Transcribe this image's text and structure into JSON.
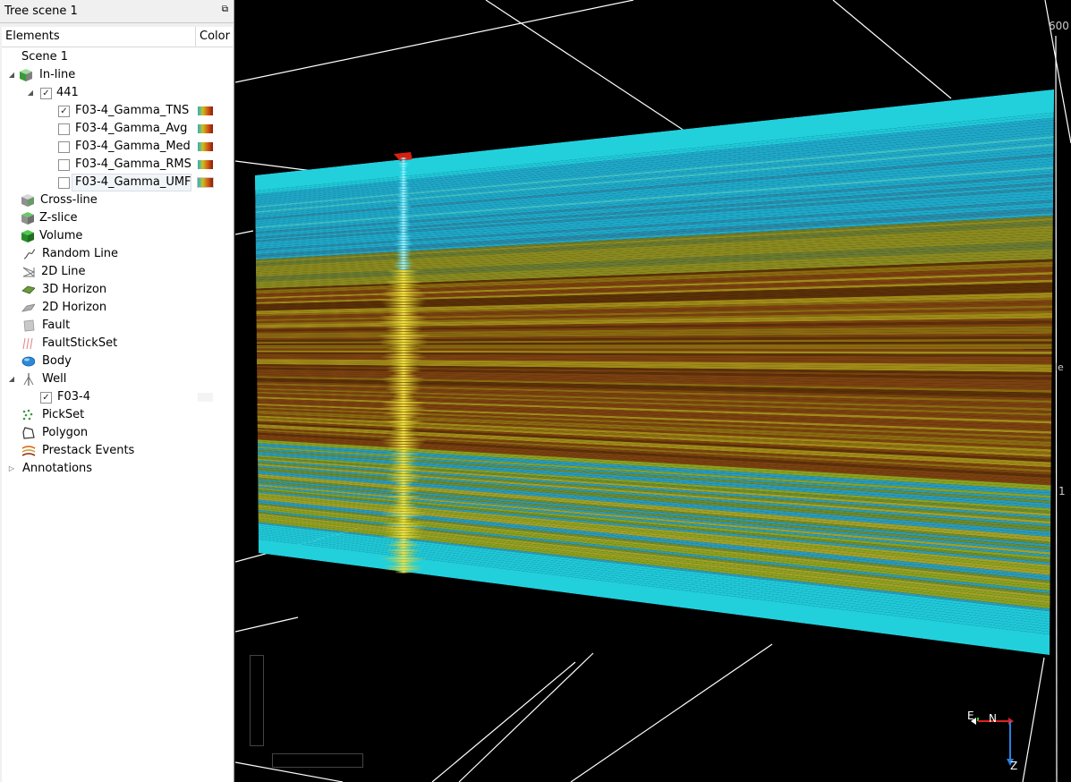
{
  "panel": {
    "title": "Tree scene 1",
    "float_icon": "restore-icon",
    "columns": {
      "elements": "Elements",
      "color": "Color"
    }
  },
  "tree": {
    "scene": "Scene 1",
    "inline": {
      "label": "In-line",
      "slice": "441",
      "attributes": [
        {
          "label": "F03-4_Gamma_TNS",
          "checked": true
        },
        {
          "label": "F03-4_Gamma_Avg",
          "checked": false
        },
        {
          "label": "F03-4_Gamma_Med",
          "checked": false
        },
        {
          "label": "F03-4_Gamma_RMS",
          "checked": false
        },
        {
          "label": "F03-4_Gamma_UMF",
          "checked": false
        }
      ]
    },
    "items": {
      "crossline": "Cross-line",
      "zslice": "Z-slice",
      "volume": "Volume",
      "randomline": "Random Line",
      "line2d": "2D Line",
      "horizon3d": "3D Horizon",
      "horizon2d": "2D Horizon",
      "fault": "Fault",
      "faultstickset": "FaultStickSet",
      "body": "Body",
      "well": "Well",
      "well_child": "F03-4",
      "pickset": "PickSet",
      "polygon": "Polygon",
      "prestack": "Prestack Events",
      "annotations": "Annotations"
    },
    "checkmark": "✓"
  },
  "viewport": {
    "axis_labels": [
      "600",
      "le",
      "1"
    ],
    "compass": {
      "e": "E",
      "n": "N",
      "z": "Z"
    },
    "colors": {
      "background": "#000000",
      "grid": "#ffffff",
      "cyan": "#1ec8d8",
      "brown": "#7a3a08",
      "yellow": "#c8c020"
    }
  }
}
